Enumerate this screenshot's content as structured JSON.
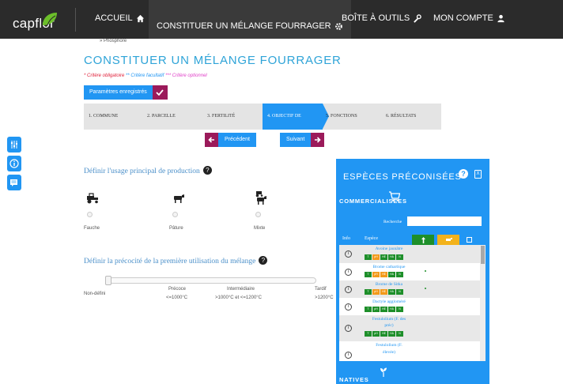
{
  "nav": {
    "logo": "capflor",
    "items": [
      {
        "label": "ACCUEIL",
        "icon": "home-icon"
      },
      {
        "label": "CONSTITUER UN MÉLANGE FOURRAGER",
        "icon": "gear-icon"
      },
      {
        "label": "BOÎTE À OUTILS",
        "icon": "wrench-icon"
      },
      {
        "label": "MON COMPTE",
        "icon": "user-icon"
      }
    ]
  },
  "breadcrumb": "» Phosphore",
  "page_title": "CONSTITUER UN MÉLANGE FOURRAGER",
  "legend": {
    "required": "* Critère obligatoire",
    "optional": "** Critère facultatif",
    "optional2": "*** Critère optionnel"
  },
  "params_button": "Paramètres enregistrés",
  "steps": [
    "1. COMMUNE",
    "2. PARCELLE",
    "3. FERTILITÉ",
    "4. OBJECTIF DE",
    "5. FONCTIONS",
    "6. RÉSULTATS"
  ],
  "prev_button": "Précédent",
  "next_button": "Suivant",
  "section_usage": {
    "title": "Définir l'usage principal de production",
    "options": [
      "Fauche",
      "Pâture",
      "Mixte"
    ]
  },
  "section_precocity": {
    "title": "Définir la précocité de la première utilisation du mélange",
    "labels": {
      "none": "Non-défini",
      "early": "Précoce",
      "early_range": "<=1000°C",
      "mid": "Intermédiaire",
      "mid_range": ">1000°C et <=1200°C",
      "late": "Tardif",
      "late_range": ">1200°C"
    }
  },
  "panel": {
    "title": "ESPÈCES PRÉCONISÉES",
    "commercial": "COMMERCIALISÉES",
    "search_label": "Recherche",
    "search_value": "",
    "col_info": "Info",
    "col_species": "Espèce",
    "species": [
      {
        "name": "Avoine jaunâtre",
        "badges": [
          "T",
          "pH",
          "HE",
          "HA",
          "N"
        ],
        "dot": false
      },
      {
        "name": "Brome cathartique",
        "badges": [
          "T",
          "pH",
          "HE",
          "HA",
          "N"
        ],
        "dot": true
      },
      {
        "name": "Brome de Sitka",
        "badges": [
          "T",
          "pH",
          "HE",
          "HA",
          "N"
        ],
        "dot": true
      },
      {
        "name": "Dactyle aggloméré",
        "badges": [
          "T",
          "pH",
          "HE",
          "HA",
          "N"
        ],
        "dot": false
      },
      {
        "name": "Festulolium (F. des",
        "name2": "préc)",
        "badges": [
          "T",
          "pH",
          "HE",
          "HA",
          "N"
        ],
        "dot": false
      },
      {
        "name": "Festulolium (F.",
        "name2": "élevée)",
        "badges": [],
        "dot": false
      }
    ],
    "natives": "NATIVES"
  },
  "colors": {
    "accent": "#2196f3",
    "brand": "#9b1a5a",
    "green": "#1e8f2a",
    "orange": "#f39a1b"
  }
}
